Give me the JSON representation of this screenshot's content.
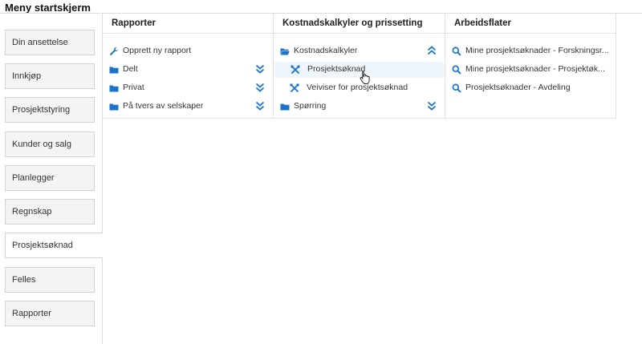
{
  "page": {
    "title": "Meny startskjerm"
  },
  "sidebar": {
    "items": [
      {
        "label": "Din ansettelse"
      },
      {
        "label": "Innkjøp"
      },
      {
        "label": "Prosjektstyring"
      },
      {
        "label": "Kunder og salg"
      },
      {
        "label": "Planlegger"
      },
      {
        "label": "Regnskap"
      },
      {
        "label": "Prosjektsøknad",
        "active": true
      },
      {
        "label": "Felles"
      },
      {
        "label": "Rapporter"
      }
    ]
  },
  "panels": {
    "rapporter": {
      "title": "Rapporter",
      "items": [
        {
          "label": "Opprett ny rapport",
          "icon": "wrench-icon"
        },
        {
          "label": "Delt",
          "icon": "folder-icon"
        },
        {
          "label": "Privat",
          "icon": "folder-icon"
        },
        {
          "label": "På tvers av selskaper",
          "icon": "folder-icon"
        }
      ]
    },
    "kostnad": {
      "title": "Kostnadskalkyler og prissetting",
      "items": [
        {
          "label": "Kostnadskalkyler",
          "icon": "folder-open-icon"
        },
        {
          "label": "Prosjektsøknad",
          "icon": "tools-icon"
        },
        {
          "label": "Veiviser for prosjektsøknad",
          "icon": "tools-icon"
        },
        {
          "label": "Spørring",
          "icon": "folder-icon"
        }
      ]
    },
    "arbeidsflater": {
      "title": "Arbeidsflater",
      "items": [
        {
          "label": "Mine prosjektsøknader - Forskningsr...",
          "icon": "search-icon"
        },
        {
          "label": "Mine prosjektsøknader - Prosjektøk...",
          "icon": "search-icon"
        },
        {
          "label": "Prosjektsøknader - Avdeling",
          "icon": "search-icon"
        }
      ]
    }
  },
  "colors": {
    "accent": "#1a73c8",
    "highlight": "#eef5fb"
  }
}
